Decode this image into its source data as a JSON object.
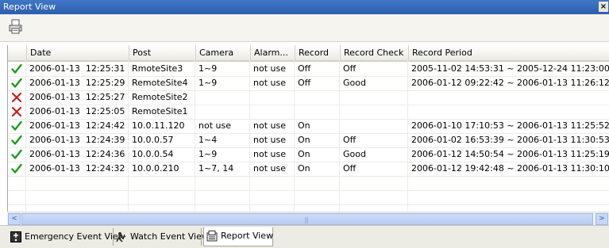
{
  "window": {
    "title": "Report View",
    "close_glyph": "×"
  },
  "toolbar": {
    "print_icon": "printer-icon"
  },
  "table": {
    "columns": [
      "Date",
      "Post",
      "Camera",
      "Alarm...",
      "Record",
      "Record Check",
      "Record Period"
    ],
    "rows": [
      {
        "status": "ok",
        "date": "2006-01-13  12:25:31",
        "post": "RmoteSite3",
        "camera": "1~9",
        "alarm": "not use",
        "record": "Off",
        "check": "Off",
        "period": "2005-11-02 14:53:31 ~ 2005-12-24 11:23:00"
      },
      {
        "status": "ok",
        "date": "2006-01-13  12:25:29",
        "post": "RemoteSite4",
        "camera": "1~9",
        "alarm": "not use",
        "record": "Off",
        "check": "Good",
        "period": "2006-01-12 09:22:42 ~ 2006-01-13 11:26:12"
      },
      {
        "status": "fail",
        "date": "2006-01-13  12:25:27",
        "post": "RemoteSite2",
        "camera": "",
        "alarm": "",
        "record": "",
        "check": "",
        "period": ""
      },
      {
        "status": "fail",
        "date": "2006-01-13  12:25:05",
        "post": "RemoteSite1",
        "camera": "",
        "alarm": "",
        "record": "",
        "check": "",
        "period": ""
      },
      {
        "status": "ok",
        "date": "2006-01-13  12:24:42",
        "post": "10.0.11.120",
        "camera": "not use",
        "alarm": "not use",
        "record": "On",
        "check": "",
        "period": "2006-01-10 17:10:53 ~ 2006-01-13 11:25:52"
      },
      {
        "status": "ok",
        "date": "2006-01-13  12:24:39",
        "post": "10.0.0.57",
        "camera": "1~4",
        "alarm": "not use",
        "record": "On",
        "check": "Off",
        "period": "2006-01-02 16:53:39 ~ 2006-01-13 11:30:53"
      },
      {
        "status": "ok",
        "date": "2006-01-13  12:24:36",
        "post": "10.0.0.54",
        "camera": "1~9",
        "alarm": "not use",
        "record": "On",
        "check": "Good",
        "period": "2006-01-12 14:50:54 ~ 2006-01-13 11:25:19"
      },
      {
        "status": "ok",
        "date": "2006-01-13  12:24:32",
        "post": "10.0.0.210",
        "camera": "1~7, 14",
        "alarm": "not use",
        "record": "On",
        "check": "Off",
        "period": "2006-01-12 19:42:48 ~ 2006-01-13 11:30:10"
      }
    ]
  },
  "scrollbar": {
    "left_glyph": "<",
    "right_glyph": ">",
    "grip_glyph": "|||"
  },
  "tabs": [
    {
      "label": "Emergency Event View",
      "icon": "emergency-icon",
      "active": false
    },
    {
      "label": "Watch Event View",
      "icon": "watch-icon",
      "active": false
    },
    {
      "label": "Report View",
      "icon": "report-icon",
      "active": true
    }
  ],
  "colors": {
    "ok": "#1f9a1f",
    "fail": "#c81e1e",
    "title_bar": "#3567b8"
  }
}
